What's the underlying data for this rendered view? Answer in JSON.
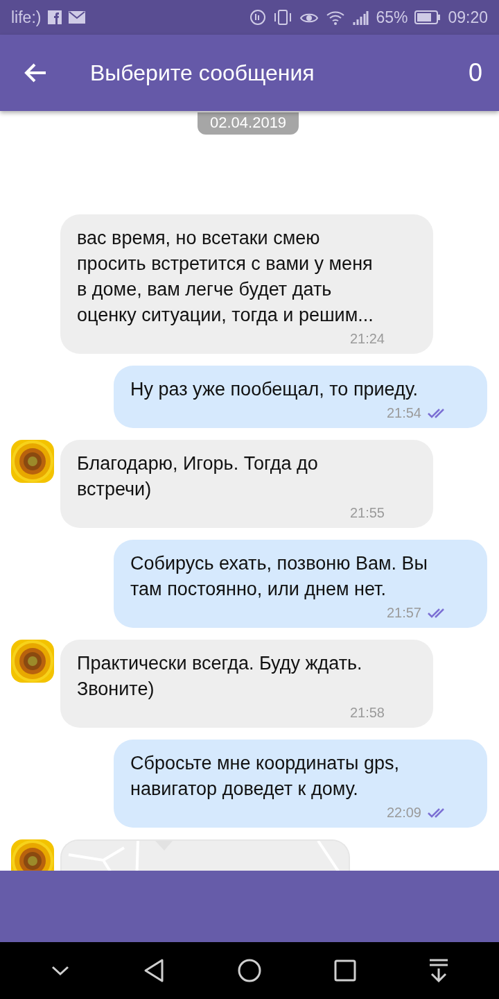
{
  "status_bar": {
    "carrier": "life:)",
    "battery": "65%",
    "time": "09:20"
  },
  "header": {
    "title": "Выберите сообщения",
    "count": "0"
  },
  "date_chip": "02.04.2019",
  "messages": [
    {
      "kind": "incoming",
      "avatar": false,
      "text": "вас время, но всетаки смею просить встретится с вами у меня в доме, вам легче будет дать оценку ситуации, тогда и решим...",
      "time": "21:24"
    },
    {
      "kind": "outgoing",
      "read": true,
      "text": "Ну раз уже пообещал, то приеду.",
      "time": "21:54"
    },
    {
      "kind": "incoming",
      "avatar": true,
      "text": "Благодарю, Игорь. Тогда до встречи)",
      "time": "21:55"
    },
    {
      "kind": "outgoing",
      "read": true,
      "text": "Собирусь ехать, позвоню Вам. Вы там постоянно, или днем нет.",
      "time": "21:57"
    },
    {
      "kind": "incoming",
      "avatar": true,
      "text": "Практически всегда. Буду ждать. Звоните)",
      "time": "21:58"
    },
    {
      "kind": "outgoing",
      "read": true,
      "text": "Сбросьте мне координаты gps, навигатор доведет к дому.",
      "time": "22:09"
    },
    {
      "kind": "location",
      "avatar": true
    }
  ]
}
